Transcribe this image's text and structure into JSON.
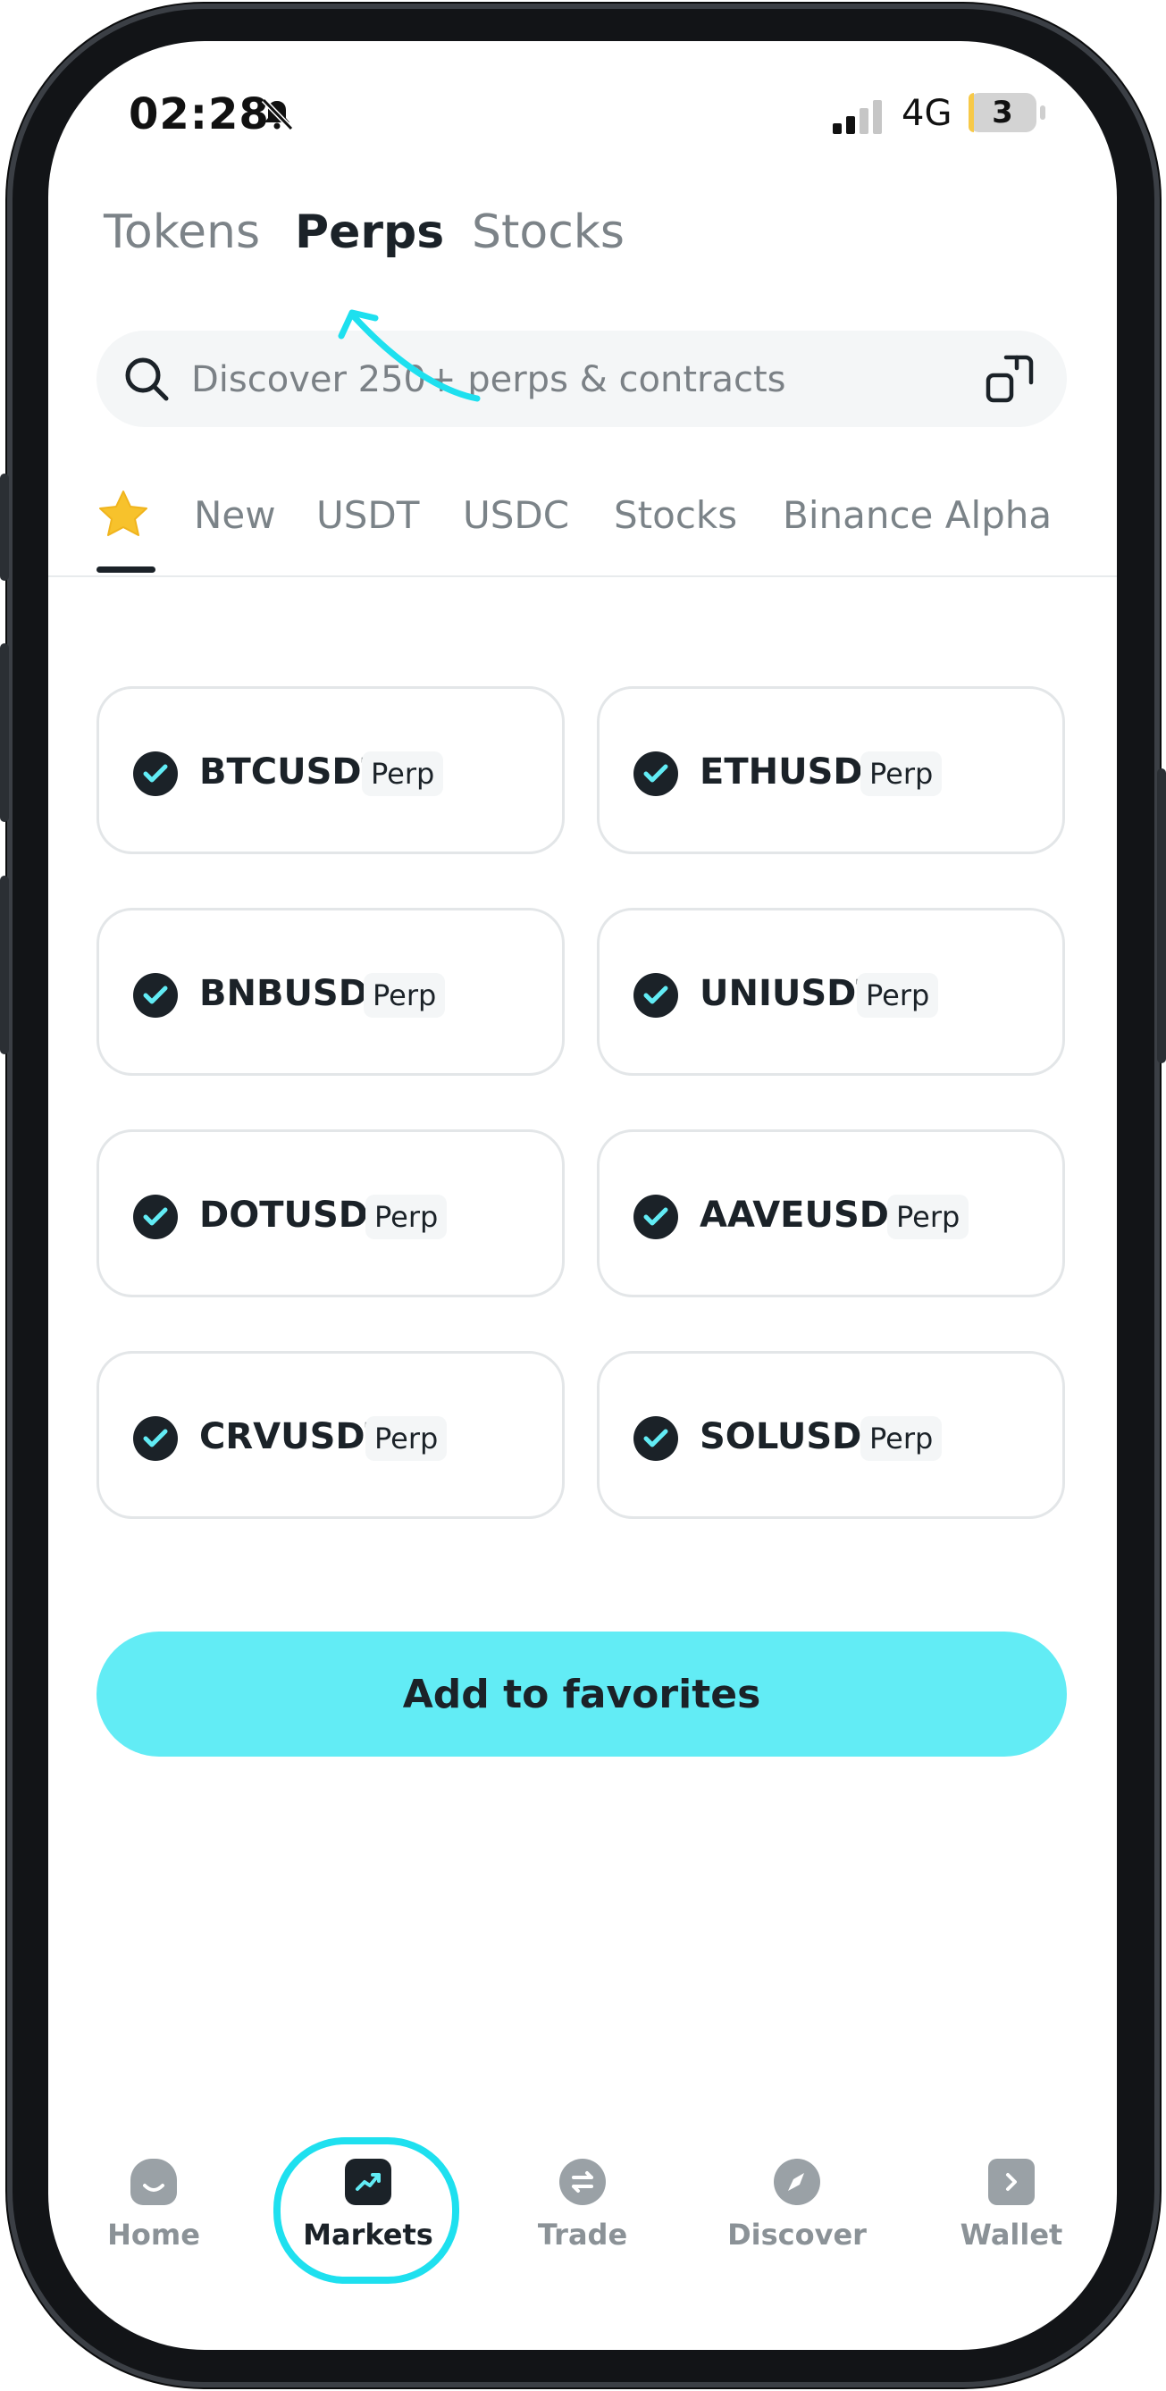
{
  "status_bar": {
    "time": "02:28",
    "network": "4G",
    "battery": "3"
  },
  "top_tabs": [
    {
      "label": "Tokens",
      "active": false
    },
    {
      "label": "Perps",
      "active": true
    },
    {
      "label": "Stocks",
      "active": false
    }
  ],
  "search": {
    "placeholder": "Discover 250+ perps & contracts"
  },
  "categories": [
    "New",
    "USDT",
    "USDC",
    "Stocks",
    "Binance Alpha"
  ],
  "cards": [
    {
      "name": "BTCUSDT",
      "badge": "Perp",
      "selected": true
    },
    {
      "name": "ETHUSDT",
      "badge": "Perp",
      "selected": true
    },
    {
      "name": "BNBUSDT",
      "badge": "Perp",
      "selected": true
    },
    {
      "name": "UNIUSDT",
      "badge": "Perp",
      "selected": true
    },
    {
      "name": "DOTUSDT",
      "badge": "Perp",
      "selected": true
    },
    {
      "name": "AAVEUSDT",
      "badge": "Perp",
      "selected": true
    },
    {
      "name": "CRVUSDT",
      "badge": "Perp",
      "selected": true
    },
    {
      "name": "SOLUSDT",
      "badge": "Perp",
      "selected": true
    }
  ],
  "cta": {
    "label": "Add to favorites"
  },
  "bottom_nav": [
    {
      "label": "Home",
      "icon": "home-icon",
      "active": false
    },
    {
      "label": "Markets",
      "icon": "markets-icon",
      "active": true
    },
    {
      "label": "Trade",
      "icon": "trade-icon",
      "active": false
    },
    {
      "label": "Discover",
      "icon": "discover-icon",
      "active": false
    },
    {
      "label": "Wallet",
      "icon": "wallet-icon",
      "active": false
    }
  ],
  "colors": {
    "accent": "#62ecf5",
    "highlight": "#1ee0ef",
    "dark": "#1b2228",
    "muted": "#7b8388"
  }
}
